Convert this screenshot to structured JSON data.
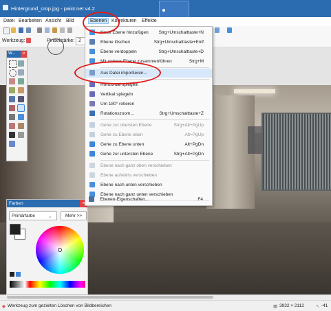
{
  "window": {
    "title": "Hintergrund_crop.jpg - paint.net v4.2"
  },
  "menubar": {
    "items": [
      "Datei",
      "Bearbeiten",
      "Ansicht",
      "Bild",
      "Ebenen",
      "Korrekturen",
      "Effekte"
    ],
    "active": "Ebenen"
  },
  "options": {
    "tool_label": "Werkzeug:",
    "brush_label": "Pinselstärke:",
    "brush_value": "2"
  },
  "tools_panel": {
    "title": "W...",
    "close": "×"
  },
  "colors_panel": {
    "title": "Farben",
    "close": "×",
    "selector_value": "Primärfarbe",
    "selector_arrow": "⌄",
    "more_button": "Mehr >>"
  },
  "layers_menu": {
    "items": [
      {
        "label": "Neue Ebene hinzufügen",
        "shortcut": "Strg+Umschalttaste+N",
        "icon": "add-layer-icon",
        "color": "#4a8fdc",
        "disabled": false
      },
      {
        "label": "Ebene löschen",
        "shortcut": "Strg+Umschalttaste+Entf",
        "icon": "delete-layer-icon",
        "color": "#5b7fb5",
        "disabled": false
      },
      {
        "label": "Ebene verdoppeln",
        "shortcut": "Strg+Umschalttaste+D",
        "icon": "duplicate-layer-icon",
        "color": "#4a8fdc",
        "disabled": false
      },
      {
        "label": "Mit unterer Ebene zusammenführen",
        "shortcut": "Strg+M",
        "icon": "merge-layer-icon",
        "color": "#4a8fdc",
        "disabled": false
      },
      {
        "label": "Aus Datei importieren...",
        "shortcut": "",
        "icon": "import-file-icon",
        "color": "#7a9cc7",
        "disabled": false,
        "highlighted": true
      },
      {
        "label": "Horizontal spiegeln",
        "shortcut": "",
        "icon": "flip-horizontal-icon",
        "color": "#6a6ab8",
        "disabled": false
      },
      {
        "label": "Vertikal spiegeln",
        "shortcut": "",
        "icon": "flip-vertical-icon",
        "color": "#6a6ab8",
        "disabled": false
      },
      {
        "label": "Um 180° rotieren",
        "shortcut": "",
        "icon": "rotate-180-icon",
        "color": "#7a7ab0",
        "disabled": false
      },
      {
        "label": "Rotationszoom...",
        "shortcut": "Strg+Umschalttaste+Z",
        "icon": "rotate-zoom-icon",
        "color": "#3d6fb5",
        "disabled": false
      },
      {
        "label": "Gehe zur obersten Ebene",
        "shortcut": "Strg+Alt+PgUp",
        "icon": "top-layer-icon",
        "color": "#9bb0c9",
        "disabled": true
      },
      {
        "label": "Gehe zu Ebene oben",
        "shortcut": "Alt+PgUp",
        "icon": "layer-up-icon",
        "color": "#9bb0c9",
        "disabled": true
      },
      {
        "label": "Gehe zu Ebene unten",
        "shortcut": "Alt+PgDn",
        "icon": "layer-down-icon",
        "color": "#3d86d9",
        "disabled": false
      },
      {
        "label": "Gehe zur untersten Ebene",
        "shortcut": "Strg+Alt+PgDn",
        "icon": "bottom-layer-icon",
        "color": "#3d86d9",
        "disabled": false
      },
      {
        "label": "Ebene nach ganz oben verschieben",
        "shortcut": "",
        "icon": "move-top-icon",
        "color": "#aab8c9",
        "disabled": true
      },
      {
        "label": "Ebene aufwärts verschieben",
        "shortcut": "",
        "icon": "move-up-icon",
        "color": "#aab8c9",
        "disabled": true
      },
      {
        "label": "Ebene nach unten verschieben",
        "shortcut": "",
        "icon": "move-down-icon",
        "color": "#4a8fdc",
        "disabled": false
      },
      {
        "label": "Ebene nach ganz unten verschieben",
        "shortcut": "",
        "icon": "move-bottom-icon",
        "color": "#4a8fdc",
        "disabled": false
      },
      {
        "label": "Ebenen-Eigenschaften...",
        "shortcut": "F4",
        "icon": "layer-properties-icon",
        "color": "#4a6fa5",
        "disabled": false
      }
    ]
  },
  "status": {
    "hint": "Werkzeug zum gezielten Löschen von Bildbereichen",
    "size": "3932 × 2112",
    "coords": "-41"
  }
}
